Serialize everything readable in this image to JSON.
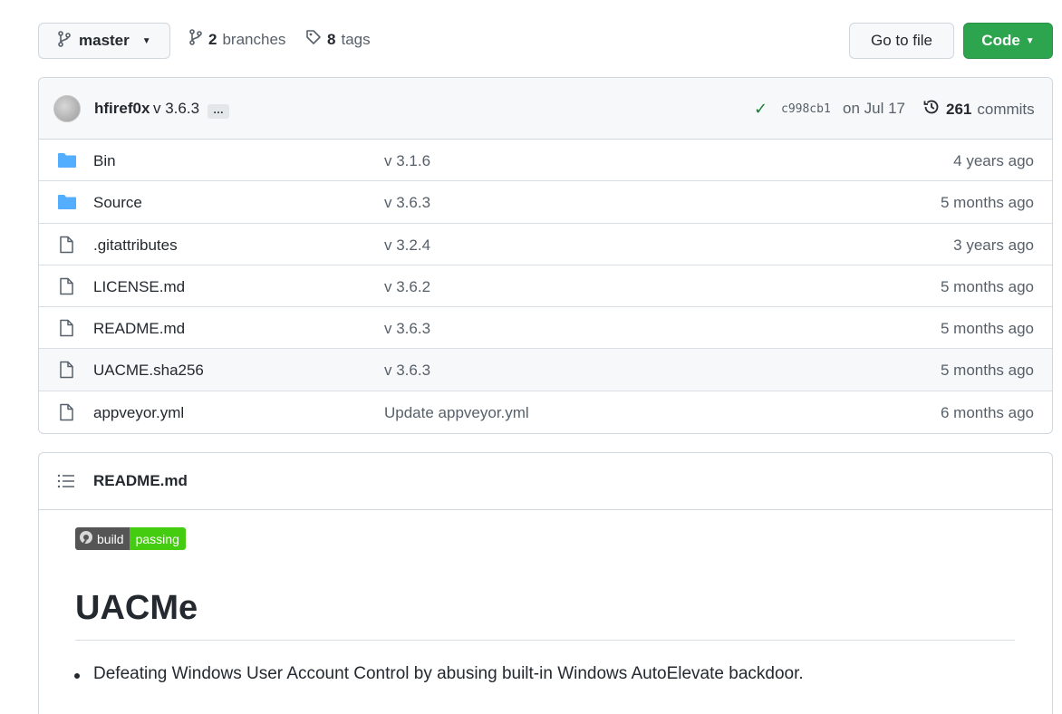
{
  "toolbar": {
    "branch_label": "master",
    "branches_count": "2",
    "branches_label": "branches",
    "tags_count": "8",
    "tags_label": "tags",
    "goto_label": "Go to file",
    "code_label": "Code"
  },
  "commit": {
    "author": "hfiref0x",
    "message": "v 3.6.3",
    "ellipsis": "…",
    "sha": "c998cb1",
    "date": "on Jul 17",
    "commits_count": "261",
    "commits_label": "commits"
  },
  "files": [
    {
      "name": "Bin",
      "type": "dir",
      "message": "v 3.1.6",
      "age": "4 years ago"
    },
    {
      "name": "Source",
      "type": "dir",
      "message": "v 3.6.3",
      "age": "5 months ago"
    },
    {
      "name": ".gitattributes",
      "type": "file",
      "message": "v 3.2.4",
      "age": "3 years ago"
    },
    {
      "name": "LICENSE.md",
      "type": "file",
      "message": "v 3.6.2",
      "age": "5 months ago"
    },
    {
      "name": "README.md",
      "type": "file",
      "message": "v 3.6.3",
      "age": "5 months ago"
    },
    {
      "name": "UACME.sha256",
      "type": "file",
      "message": "v 3.6.3",
      "age": "5 months ago"
    },
    {
      "name": "appveyor.yml",
      "type": "file",
      "message": "Update appveyor.yml",
      "age": "6 months ago"
    }
  ],
  "readme": {
    "title": "README.md",
    "badge_left": "build",
    "badge_right": "passing",
    "heading": "UACMe",
    "bullet": "Defeating Windows User Account Control by abusing built-in Windows AutoElevate backdoor."
  },
  "colors": {
    "folder": "#54aeff",
    "code_button": "#2da44e",
    "check": "#1a7f37",
    "badge_pass": "#44cc11"
  }
}
